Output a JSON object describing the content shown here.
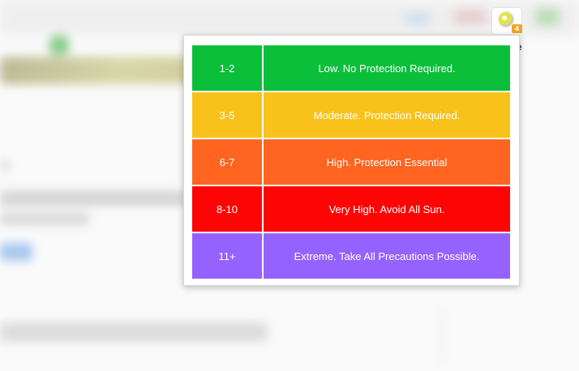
{
  "extension": {
    "icon": "sun-icon",
    "badge": "4",
    "fragment_letter": "e"
  },
  "uv_scale": {
    "rows": [
      {
        "range": "1-2",
        "description": "Low. No Protection Required.",
        "color": "#0bbf3a"
      },
      {
        "range": "3-5",
        "description": "Moderate. Protection Required.",
        "color": "#f8c21b"
      },
      {
        "range": "6-7",
        "description": "High. Protection Essential",
        "color": "#ff6520"
      },
      {
        "range": "8-10",
        "description": "Very High. Avoid All Sun.",
        "color": "#fe0505"
      },
      {
        "range": "11+",
        "description": "Extreme. Take All Precautions Possible.",
        "color": "#9662ff"
      }
    ]
  }
}
